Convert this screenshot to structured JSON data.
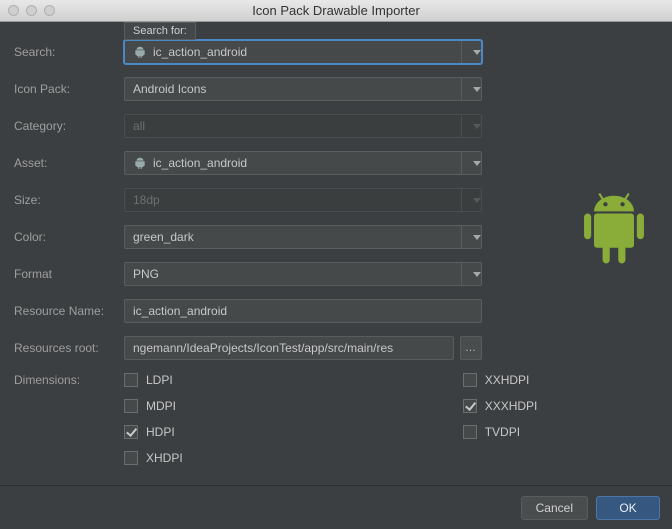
{
  "window": {
    "title": "Icon Pack Drawable Importer"
  },
  "labels": {
    "search": "Search:",
    "iconpack": "Icon Pack:",
    "category": "Category:",
    "asset": "Asset:",
    "size": "Size:",
    "color": "Color:",
    "format": "Format",
    "resname": "Resource Name:",
    "resroot": "Resources root:",
    "dimensions": "Dimensions:"
  },
  "tooltip": "Search for:",
  "fields": {
    "search": "ic_action_android",
    "iconpack": "Android Icons",
    "category": "all",
    "asset": "ic_action_android",
    "size": "18dp",
    "color": "green_dark",
    "format": "PNG",
    "resname": "ic_action_android",
    "resroot": "ngemann/IdeaProjects/IconTest/app/src/main/res"
  },
  "dimensions": {
    "left": [
      {
        "label": "LDPI",
        "checked": false
      },
      {
        "label": "MDPI",
        "checked": false
      },
      {
        "label": "HDPI",
        "checked": true
      },
      {
        "label": "XHDPI",
        "checked": false
      }
    ],
    "right": [
      {
        "label": "XXHDPI",
        "checked": false
      },
      {
        "label": "XXXHDPI",
        "checked": true
      },
      {
        "label": "TVDPI",
        "checked": false
      }
    ]
  },
  "buttons": {
    "cancel": "Cancel",
    "ok": "OK",
    "help": "?",
    "browse": "…"
  },
  "colors": {
    "android": "#8aad3a"
  }
}
